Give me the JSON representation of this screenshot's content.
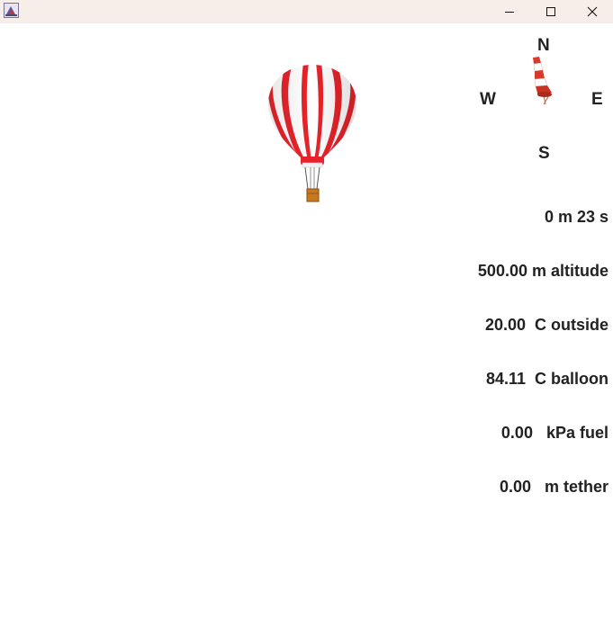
{
  "titlebar": {
    "title": "",
    "app_icon": "java-app-icon",
    "minimize_icon": "minimize-icon",
    "maximize_icon": "maximize-icon",
    "close_icon": "close-icon"
  },
  "compass": {
    "north": "N",
    "south": "S",
    "east": "E",
    "west": "W"
  },
  "balloon": {
    "icon": "hot-air-balloon-icon",
    "colors": {
      "stripe_red": "#e8232b",
      "stripe_white": "#ffffff",
      "basket": "#c8781e"
    }
  },
  "windsock": {
    "icon": "windsock-icon",
    "colors": {
      "red": "#d9382a",
      "white": "#ffffff"
    }
  },
  "readout": {
    "lines": [
      "0 m 23 s",
      "500.00 m altitude",
      "20.00  C outside",
      "84.11  C balloon",
      "0.00   kPa fuel",
      "0.00   m tether"
    ]
  }
}
